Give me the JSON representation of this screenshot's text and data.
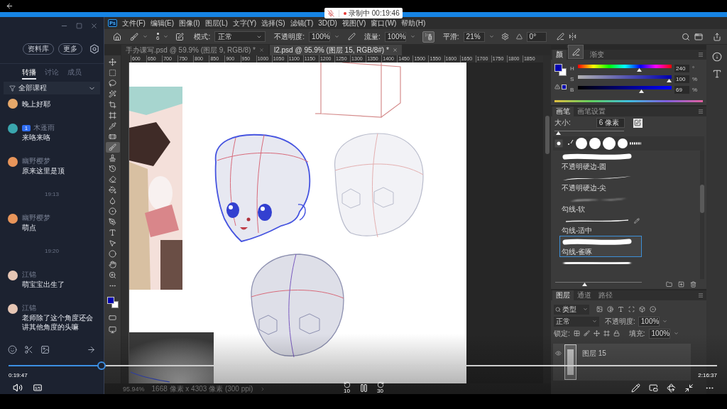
{
  "recording": {
    "text": "录制中 00:19:46"
  },
  "chat": {
    "buttons": [
      "资料库",
      "更多"
    ],
    "tabs": [
      {
        "label": "转播",
        "selected": true
      },
      {
        "label": "讨论",
        "selected": false
      },
      {
        "label": "成员",
        "selected": false
      }
    ],
    "filter": "全部课程",
    "messages": [
      {
        "kind": "message",
        "text": "晚上好耶",
        "color": "#e6a86a"
      },
      {
        "kind": "message",
        "badge": "1",
        "name": "木蓬雨",
        "text": "来咯来咯",
        "color": "#3aa6ae"
      },
      {
        "kind": "message",
        "name": "幽野樱梦",
        "text": "原来这里是顶",
        "color": "#e8955a"
      },
      {
        "kind": "time",
        "text": "19:13"
      },
      {
        "kind": "message",
        "name": "幽野樱梦",
        "text": "萌点",
        "color": "#e8955a"
      },
      {
        "kind": "time",
        "text": "19:20"
      },
      {
        "kind": "message",
        "name": "江锦",
        "text": "萌宝宝出生了",
        "color": "#e6c6b4"
      },
      {
        "kind": "message",
        "name": "江锦",
        "text": "老师除了这个角度还会讲其他角度的头嘛",
        "color": "#e6c6b4"
      }
    ]
  },
  "photoshop": {
    "logo": "Ps",
    "menu": [
      "文件(F)",
      "编辑(E)",
      "图像(I)",
      "图层(L)",
      "文字(Y)",
      "选择(S)",
      "滤镜(T)",
      "3D(D)",
      "视图(V)",
      "窗口(W)",
      "帮助(H)"
    ],
    "options": {
      "brush_size": "6",
      "mode_label": "模式:",
      "mode": "正常",
      "opacity_label": "不透明度:",
      "opacity": "100%",
      "flow_label": "流量:",
      "flow": "100%",
      "airbrush": true,
      "smoothing_label": "平滑:",
      "smoothing": "21%",
      "angle": "0°"
    },
    "documents": [
      {
        "title": "手办课写.psd @ 59.9% (图层 9, RGB/8) *",
        "selected": false
      },
      {
        "title": "l2.psd @ 95.9% (图层 15, RGB/8#) *",
        "selected": true
      }
    ],
    "ruler": [
      "600",
      "650",
      "700",
      "750",
      "800",
      "850",
      "900",
      "950",
      "1000",
      "1050",
      "1100",
      "1150",
      "1200",
      "1250",
      "1300",
      "1350",
      "1400",
      "1450",
      "1500",
      "1550",
      "1600",
      "1650",
      "1700",
      "1750",
      "1800",
      "1850"
    ],
    "tools": [
      {
        "kind": "move",
        "selected": false
      },
      {
        "kind": "marquee",
        "selected": false
      },
      {
        "kind": "lasso",
        "selected": false
      },
      {
        "kind": "wand",
        "selected": false
      },
      {
        "kind": "crop",
        "selected": false
      },
      {
        "kind": "frame",
        "selected": false
      },
      {
        "kind": "eyedropper",
        "selected": false
      },
      {
        "kind": "healing",
        "selected": false
      },
      {
        "kind": "brush",
        "selected": true
      },
      {
        "kind": "stamp",
        "selected": false
      },
      {
        "kind": "history",
        "selected": false
      },
      {
        "kind": "eraser",
        "selected": false
      },
      {
        "kind": "bucket",
        "selected": false
      },
      {
        "kind": "blur",
        "selected": false
      },
      {
        "kind": "dodge",
        "selected": false
      },
      {
        "kind": "pen",
        "selected": false
      },
      {
        "kind": "type",
        "selected": false
      },
      {
        "kind": "select",
        "selected": false
      },
      {
        "kind": "shape",
        "selected": false
      },
      {
        "kind": "hand",
        "selected": false
      },
      {
        "kind": "zoom",
        "selected": false
      },
      {
        "kind": "more",
        "selected": false
      }
    ],
    "status": {
      "zoom": "95.94%",
      "dimensions": "1668 像素 x 4303 像素 (300 ppi)"
    },
    "color_panel": {
      "tabs": [
        {
          "label": "颜",
          "selected": true
        },
        {
          "label": "渐变",
          "selected": false
        }
      ],
      "sliders": [
        {
          "kind": "hue",
          "label": "H",
          "value": "240",
          "unit": "°",
          "level": 0.667
        },
        {
          "kind": "saturation",
          "label": "S",
          "value": "100",
          "unit": "%",
          "level": 1
        },
        {
          "kind": "brightness",
          "label": "B",
          "value": "69",
          "unit": "%",
          "level": 0.69
        }
      ]
    },
    "brush_panel": {
      "tabs": [
        {
          "label": "画笔",
          "selected": true
        },
        {
          "label": "画笔设置",
          "selected": false
        }
      ],
      "size_label": "大小:",
      "size": "6 像素",
      "size_slider": {
        "level": 0.02
      },
      "presets": [
        {
          "kind": "hard",
          "name": "不透明硬边-圆",
          "selected": false,
          "pencil_mark": false
        },
        {
          "kind": "taper",
          "name": "不透明硬边-尖",
          "selected": false,
          "pencil_mark": false
        },
        {
          "kind": "soft",
          "name": "勾线-软",
          "selected": false,
          "pencil_mark": false
        },
        {
          "kind": "thin",
          "name": "勾线-适中",
          "selected": false,
          "pencil_mark": true
        },
        {
          "kind": "hard",
          "name": "勾线-雀啄",
          "selected": true,
          "pencil_mark": false
        },
        {
          "kind": "fuzzy",
          "selected": false,
          "pencil_mark": false
        }
      ],
      "preview_slider": {
        "level": 0.33
      }
    },
    "layers_panel": {
      "tabs": [
        {
          "label": "图层",
          "selected": true
        },
        {
          "label": "通道",
          "selected": false
        },
        {
          "label": "路径",
          "selected": false
        }
      ],
      "filter": "类型",
      "blend_mode": "正常",
      "opacity_label": "不透明度:",
      "opacity": "100%",
      "lock_label": "锁定:",
      "fill_label": "填充:",
      "fill": "100%",
      "layers": [
        {
          "name": "图层 15",
          "visible": true,
          "selected": true
        }
      ]
    }
  },
  "player": {
    "progress": {
      "level": 0.131
    },
    "elapsed": "0:19:47",
    "duration": "2:16:37",
    "playing": true,
    "skip_back": "10",
    "skip_forward": "30"
  }
}
